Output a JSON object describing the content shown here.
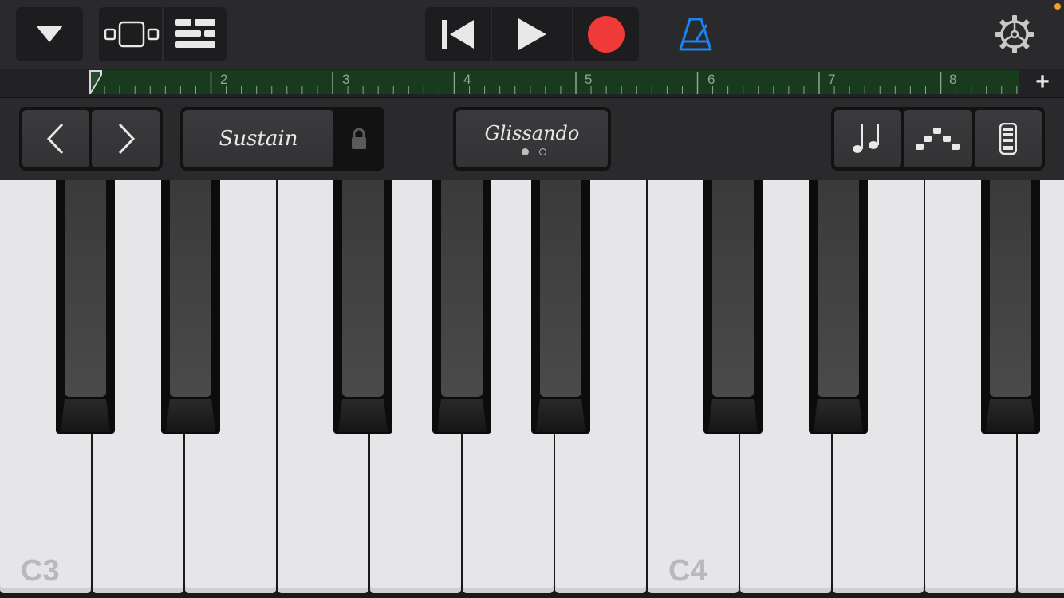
{
  "toolbar": {
    "icons": {
      "menu": "dropdown-triangle-icon",
      "browser": "tracks-view-icon",
      "tracks": "tracks-list-icon",
      "rewind": "go-to-beginning-icon",
      "play": "play-icon",
      "record": "record-icon",
      "metronome": "metronome-icon",
      "settings": "settings-gear-icon"
    },
    "colors": {
      "record": "#f03a38",
      "metronome": "#1a84f0",
      "notification": "#f0a020"
    }
  },
  "ruler": {
    "bars": [
      "2",
      "3",
      "4",
      "5",
      "6",
      "7",
      "8"
    ],
    "add_label": "+"
  },
  "controls": {
    "sustain_label": "Sustain",
    "glissando_label": "Glissando",
    "page_dots": 2,
    "active_page": 1
  },
  "keyboard": {
    "octave_labels": {
      "c3": "C3",
      "c4": "C4"
    }
  }
}
